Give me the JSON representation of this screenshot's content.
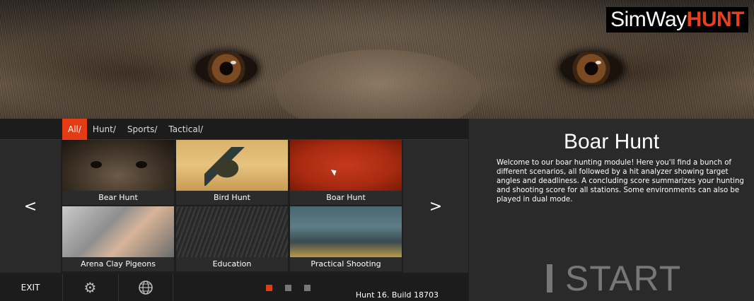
{
  "logo": {
    "part1": "SimWay",
    "part2": "HUNT"
  },
  "filters": [
    "All/",
    "Hunt/",
    "Sports/",
    "Tactical/"
  ],
  "nav": {
    "prev": "<",
    "next": ">"
  },
  "tiles": [
    {
      "label": "Bear Hunt"
    },
    {
      "label": "Bird Hunt"
    },
    {
      "label": "Boar Hunt"
    },
    {
      "label": "Arena Clay Pigeons"
    },
    {
      "label": "Education"
    },
    {
      "label": "Practical Shooting"
    }
  ],
  "bottom": {
    "exit": "EXIT",
    "build": "Hunt 16. Build 18703"
  },
  "info": {
    "title": "Boar Hunt",
    "description": "Welcome to our boar hunting module! Here you'll find a bunch of different scenarios, all followed by a hit analyzer showing target angles and deadliness. A concluding score summarizes your hunting and shooting score for all stations. Some environments can also be played in dual mode.",
    "start": "START"
  },
  "colors": {
    "accent": "#e33c12",
    "panel": "#2a2a2b"
  },
  "icons": {
    "settings": "gear-icon",
    "globe": "globe-icon"
  }
}
